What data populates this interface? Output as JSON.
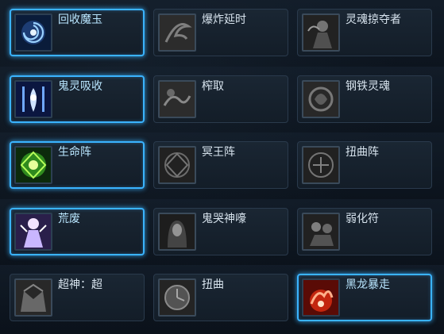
{
  "skills": [
    [
      {
        "name": "回收魔玉",
        "icon": "vortex-orb-icon",
        "active": true
      },
      {
        "name": "爆炸延时",
        "icon": "swirl-blast-icon",
        "active": false
      },
      {
        "name": "灵魂掠夺者",
        "icon": "soul-reaper-icon",
        "active": false
      }
    ],
    [
      {
        "name": "鬼灵吸收",
        "icon": "ghost-absorb-icon",
        "active": true
      },
      {
        "name": "榨取",
        "icon": "extract-icon",
        "active": false
      },
      {
        "name": "钢铁灵魂",
        "icon": "steel-soul-icon",
        "active": false
      }
    ],
    [
      {
        "name": "生命阵",
        "icon": "life-array-icon",
        "active": true
      },
      {
        "name": "冥王阵",
        "icon": "hades-array-icon",
        "active": false
      },
      {
        "name": "扭曲阵",
        "icon": "twist-array-icon",
        "active": false
      }
    ],
    [
      {
        "name": "荒废",
        "icon": "desolation-icon",
        "active": true
      },
      {
        "name": "鬼哭神嚎",
        "icon": "ghost-wail-icon",
        "active": false
      },
      {
        "name": "弱化符",
        "icon": "weaken-rune-icon",
        "active": false
      }
    ],
    [
      {
        "name": "超神：超",
        "icon": "super-god-icon",
        "active": false
      },
      {
        "name": "扭曲",
        "icon": "twist-clock-icon",
        "active": false
      },
      {
        "name": "黑龙暴走",
        "icon": "black-dragon-icon",
        "active": true
      }
    ]
  ],
  "colors": {
    "active_border": "#3ab3ff",
    "background": "#0a1119",
    "text": "#d8e4ee"
  }
}
